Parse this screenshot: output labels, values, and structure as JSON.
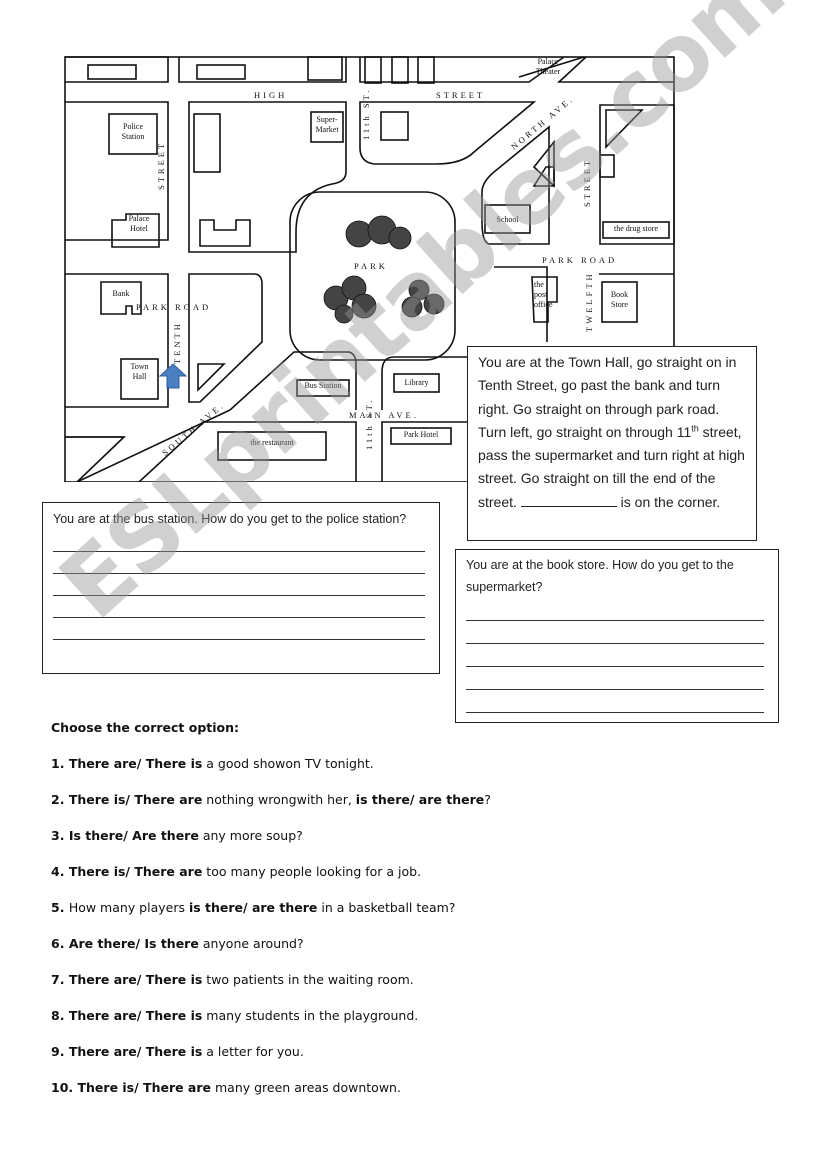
{
  "map": {
    "streets": {
      "high": "HIGH",
      "high_street": "STREET",
      "street_left": "STREET",
      "street_right": "STREET",
      "eleventh_top": "11th ST.",
      "eleventh_bottom": "11th ST.",
      "north_ave": "NORTH AVE.",
      "park_road_left": "PARK ROAD",
      "park_road_right": "PARK ROAD",
      "park": "PARK",
      "tenth": "TENTH",
      "twelfth": "TWELFTH",
      "south_ave": "SOUTH AVE.",
      "main_ave": "MAIN AVE."
    },
    "buildings": {
      "police_station": [
        "Police",
        "Station"
      ],
      "palace_hotel": [
        "Palace",
        "Hotel"
      ],
      "supermarket": [
        "Super-",
        "Market"
      ],
      "palace_theater": [
        "Palace",
        "Theater"
      ],
      "school": "School",
      "drug_store": "the drug store",
      "bank": "Bank",
      "town_hall": [
        "Town",
        "Hall"
      ],
      "post_office": [
        "the",
        "post",
        "office"
      ],
      "book_store": [
        "Book",
        "Store"
      ],
      "bus_station": "Bus Station",
      "library": "Library",
      "restaurant": "the restaurant",
      "park_hotel": "Park Hotel"
    },
    "arrow_color": "#4a7fc1",
    "arrow_icon": "up-arrow"
  },
  "directions": {
    "text_before": "You are at the Town Hall,  go straight on in Tenth Street, go past the bank and turn right. Go straight on through park road. Turn left, go straight on through 11",
    "sup": "th",
    "text_middle": " street, pass the supermarket and turn right at high street. Go straight on till the end of the street. ",
    "blank": "____________",
    "text_after": " is on the corner."
  },
  "question1": {
    "prompt": "You are at the bus station. How do you get to the police station?",
    "answer_lines": 5
  },
  "question2": {
    "prompt": "You are at the book store. How do you get to the supermarket?",
    "answer_lines": 5
  },
  "exercise": {
    "heading": "Choose the correct option:",
    "items": [
      {
        "num": "1.",
        "parts": [
          {
            "b": "There are/ There is"
          },
          {
            "t": " a good showon TV tonight."
          }
        ]
      },
      {
        "num": "2.",
        "parts": [
          {
            "b": "There is/ There are"
          },
          {
            "t": " nothing wrongwith her, "
          },
          {
            "b": "is there/ are there"
          },
          {
            "t": "?"
          }
        ]
      },
      {
        "num": "3.",
        "parts": [
          {
            "b": "Is there/ Are there"
          },
          {
            "t": " any more soup?"
          }
        ]
      },
      {
        "num": "4.",
        "parts": [
          {
            "b": "There is/ There are"
          },
          {
            "t": " too many people looking for a job."
          }
        ]
      },
      {
        "num": "5.",
        "parts": [
          {
            "t": "How many players "
          },
          {
            "b": "is there/ are there"
          },
          {
            "t": " in a basketball team?"
          }
        ]
      },
      {
        "num": "6.",
        "parts": [
          {
            "b": "Are there/ Is there"
          },
          {
            "t": " anyone around?"
          }
        ]
      },
      {
        "num": "7.",
        "parts": [
          {
            "b": "There are/ There is"
          },
          {
            "t": " two patients in the waiting room."
          }
        ]
      },
      {
        "num": "8.",
        "parts": [
          {
            "b": "There are/ There is"
          },
          {
            "t": " many students in the playground."
          }
        ]
      },
      {
        "num": "9.",
        "parts": [
          {
            "b": "There are/ There is"
          },
          {
            "t": " a letter for you."
          }
        ]
      },
      {
        "num": "10.",
        "parts": [
          {
            "b": "There is/ There are"
          },
          {
            "t": " many green areas downtown."
          }
        ]
      }
    ]
  },
  "watermark": "ESLprintables.com"
}
